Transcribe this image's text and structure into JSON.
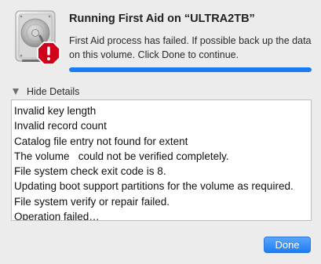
{
  "dialog": {
    "title": "Running First Aid on “ULTRA2TB”",
    "message": "First Aid process has failed. If possible back up the data on this volume. Click Done to continue.",
    "progress": 1.0,
    "icon": "hard-disk-icon",
    "badge_icon": "error-badge-icon",
    "accent_color": "#1a7cf5",
    "error_color": "#d0021b"
  },
  "details": {
    "toggle_label": "Hide Details",
    "log_lines": [
      "Invalid key length",
      "Invalid record count",
      "Catalog file entry not found for extent",
      "The volume   could not be verified completely.",
      "File system check exit code is 8.",
      "Updating boot support partitions for the volume as required.",
      "File system verify or repair failed.",
      "Operation failed…"
    ]
  },
  "buttons": {
    "done_label": "Done"
  }
}
